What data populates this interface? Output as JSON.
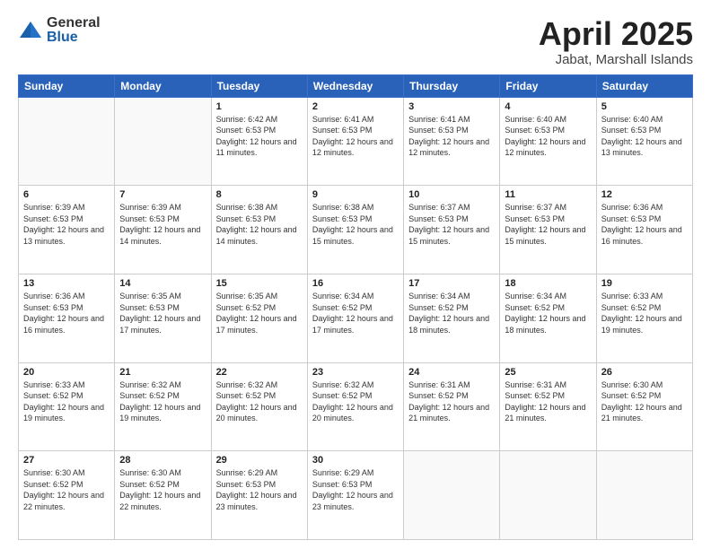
{
  "logo": {
    "general": "General",
    "blue": "Blue"
  },
  "title": {
    "month": "April 2025",
    "location": "Jabat, Marshall Islands"
  },
  "weekdays": [
    "Sunday",
    "Monday",
    "Tuesday",
    "Wednesday",
    "Thursday",
    "Friday",
    "Saturday"
  ],
  "weeks": [
    [
      {
        "day": null,
        "info": null
      },
      {
        "day": null,
        "info": null
      },
      {
        "day": "1",
        "info": "Sunrise: 6:42 AM\nSunset: 6:53 PM\nDaylight: 12 hours and 11 minutes."
      },
      {
        "day": "2",
        "info": "Sunrise: 6:41 AM\nSunset: 6:53 PM\nDaylight: 12 hours and 12 minutes."
      },
      {
        "day": "3",
        "info": "Sunrise: 6:41 AM\nSunset: 6:53 PM\nDaylight: 12 hours and 12 minutes."
      },
      {
        "day": "4",
        "info": "Sunrise: 6:40 AM\nSunset: 6:53 PM\nDaylight: 12 hours and 12 minutes."
      },
      {
        "day": "5",
        "info": "Sunrise: 6:40 AM\nSunset: 6:53 PM\nDaylight: 12 hours and 13 minutes."
      }
    ],
    [
      {
        "day": "6",
        "info": "Sunrise: 6:39 AM\nSunset: 6:53 PM\nDaylight: 12 hours and 13 minutes."
      },
      {
        "day": "7",
        "info": "Sunrise: 6:39 AM\nSunset: 6:53 PM\nDaylight: 12 hours and 14 minutes."
      },
      {
        "day": "8",
        "info": "Sunrise: 6:38 AM\nSunset: 6:53 PM\nDaylight: 12 hours and 14 minutes."
      },
      {
        "day": "9",
        "info": "Sunrise: 6:38 AM\nSunset: 6:53 PM\nDaylight: 12 hours and 15 minutes."
      },
      {
        "day": "10",
        "info": "Sunrise: 6:37 AM\nSunset: 6:53 PM\nDaylight: 12 hours and 15 minutes."
      },
      {
        "day": "11",
        "info": "Sunrise: 6:37 AM\nSunset: 6:53 PM\nDaylight: 12 hours and 15 minutes."
      },
      {
        "day": "12",
        "info": "Sunrise: 6:36 AM\nSunset: 6:53 PM\nDaylight: 12 hours and 16 minutes."
      }
    ],
    [
      {
        "day": "13",
        "info": "Sunrise: 6:36 AM\nSunset: 6:53 PM\nDaylight: 12 hours and 16 minutes."
      },
      {
        "day": "14",
        "info": "Sunrise: 6:35 AM\nSunset: 6:53 PM\nDaylight: 12 hours and 17 minutes."
      },
      {
        "day": "15",
        "info": "Sunrise: 6:35 AM\nSunset: 6:52 PM\nDaylight: 12 hours and 17 minutes."
      },
      {
        "day": "16",
        "info": "Sunrise: 6:34 AM\nSunset: 6:52 PM\nDaylight: 12 hours and 17 minutes."
      },
      {
        "day": "17",
        "info": "Sunrise: 6:34 AM\nSunset: 6:52 PM\nDaylight: 12 hours and 18 minutes."
      },
      {
        "day": "18",
        "info": "Sunrise: 6:34 AM\nSunset: 6:52 PM\nDaylight: 12 hours and 18 minutes."
      },
      {
        "day": "19",
        "info": "Sunrise: 6:33 AM\nSunset: 6:52 PM\nDaylight: 12 hours and 19 minutes."
      }
    ],
    [
      {
        "day": "20",
        "info": "Sunrise: 6:33 AM\nSunset: 6:52 PM\nDaylight: 12 hours and 19 minutes."
      },
      {
        "day": "21",
        "info": "Sunrise: 6:32 AM\nSunset: 6:52 PM\nDaylight: 12 hours and 19 minutes."
      },
      {
        "day": "22",
        "info": "Sunrise: 6:32 AM\nSunset: 6:52 PM\nDaylight: 12 hours and 20 minutes."
      },
      {
        "day": "23",
        "info": "Sunrise: 6:32 AM\nSunset: 6:52 PM\nDaylight: 12 hours and 20 minutes."
      },
      {
        "day": "24",
        "info": "Sunrise: 6:31 AM\nSunset: 6:52 PM\nDaylight: 12 hours and 21 minutes."
      },
      {
        "day": "25",
        "info": "Sunrise: 6:31 AM\nSunset: 6:52 PM\nDaylight: 12 hours and 21 minutes."
      },
      {
        "day": "26",
        "info": "Sunrise: 6:30 AM\nSunset: 6:52 PM\nDaylight: 12 hours and 21 minutes."
      }
    ],
    [
      {
        "day": "27",
        "info": "Sunrise: 6:30 AM\nSunset: 6:52 PM\nDaylight: 12 hours and 22 minutes."
      },
      {
        "day": "28",
        "info": "Sunrise: 6:30 AM\nSunset: 6:52 PM\nDaylight: 12 hours and 22 minutes."
      },
      {
        "day": "29",
        "info": "Sunrise: 6:29 AM\nSunset: 6:53 PM\nDaylight: 12 hours and 23 minutes."
      },
      {
        "day": "30",
        "info": "Sunrise: 6:29 AM\nSunset: 6:53 PM\nDaylight: 12 hours and 23 minutes."
      },
      {
        "day": null,
        "info": null
      },
      {
        "day": null,
        "info": null
      },
      {
        "day": null,
        "info": null
      }
    ]
  ]
}
